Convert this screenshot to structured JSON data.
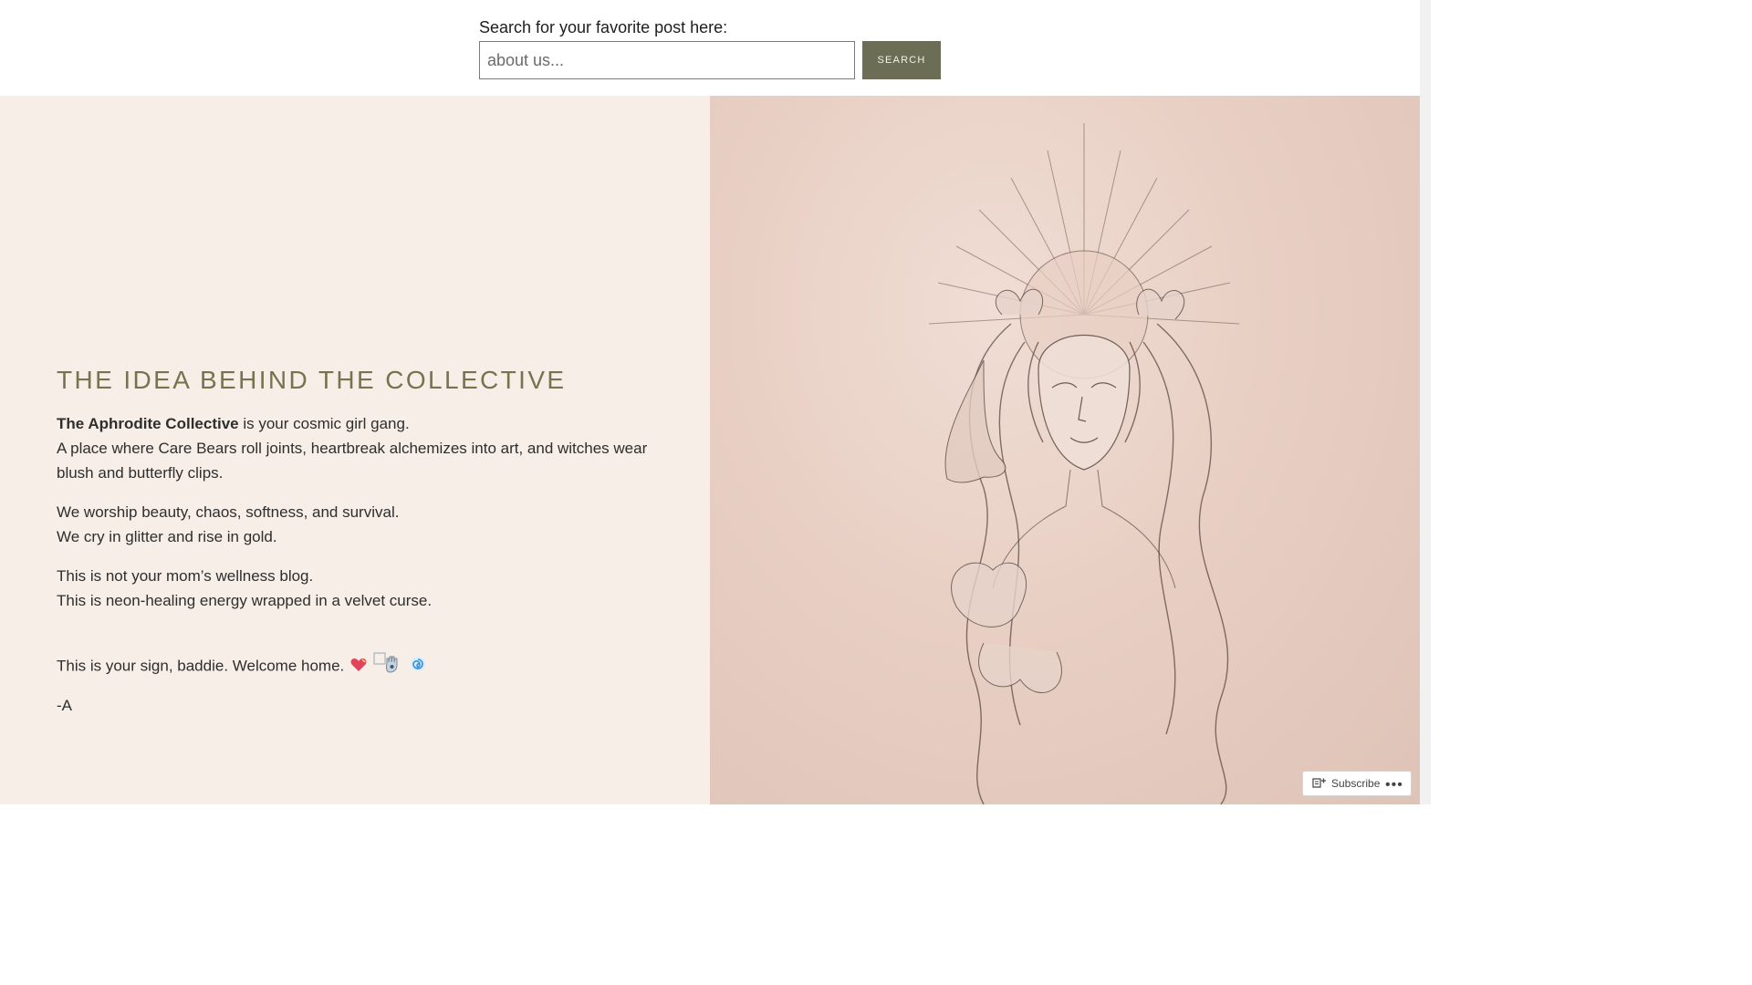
{
  "search": {
    "label": "Search for your favorite post here:",
    "placeholder": "about us...",
    "button_label": "SEARCH"
  },
  "about": {
    "heading": "THE IDEA BEHIND THE COLLECTIVE",
    "intro_bold": "The Aphrodite Collective",
    "intro_rest": " is your cosmic girl gang.",
    "line2": "A place where Care Bears roll joints, heartbreak alchemizes into art, and witches wear blush and butterfly clips.",
    "line3": "We worship beauty, chaos, softness, and survival.",
    "line4": "We cry in glitter and rise in gold.",
    "line5": "This is not your mom’s wellness blog.",
    "line6": "This is neon-healing energy wrapped in a velvet curse.",
    "line7": "This is your sign, baddie. Welcome home.",
    "signoff": "-A",
    "emoji_icons": [
      "heart-icon",
      "hamsa-icon",
      "swirl-icon"
    ]
  },
  "image": {
    "icon": "goddess-illustration"
  },
  "widget": {
    "subscribe_label": "Subscribe",
    "more_label": "•••"
  },
  "colors": {
    "accent_button": "#6b6e55",
    "heading": "#76734f",
    "left_panel": "#f7eee7",
    "right_panel": "#e8cfc4"
  }
}
